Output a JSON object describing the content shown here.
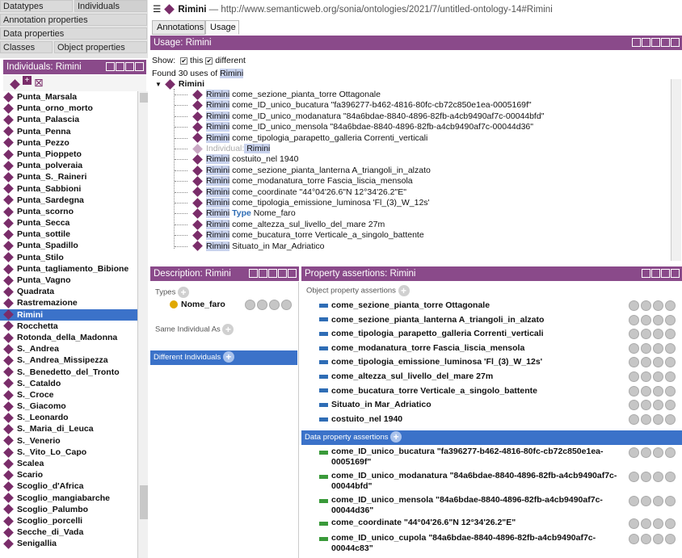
{
  "left_tabs": {
    "datatypes": "Datatypes",
    "individuals": "Individuals",
    "annotation_properties": "Annotation properties",
    "data_properties": "Data properties",
    "classes": "Classes",
    "object_properties": "Object properties"
  },
  "individuals_panel": {
    "title": "Individuals: Rimini",
    "items": [
      "Punta_Marsala",
      "Punta_orno_morto",
      "Punta_Palascia",
      "Punta_Penna",
      "Punta_Pezzo",
      "Punta_Pioppeto",
      "Punta_polveraia",
      "Punta_S._Raineri",
      "Punta_Sabbioni",
      "Punta_Sardegna",
      "Punta_scorno",
      "Punta_Secca",
      "Punta_sottile",
      "Punta_Spadillo",
      "Punta_Stilo",
      "Punta_tagliamento_Bibione",
      "Punta_Vagno",
      "Quadrata",
      "Rastremazione",
      "Rimini",
      "Rocchetta",
      "Rotonda_della_Madonna",
      "S._Andrea",
      "S._Andrea_Missipezza",
      "S._Benedetto_del_Tronto",
      "S._Cataldo",
      "S._Croce",
      "S._Giacomo",
      "S._Leonardo",
      "S._Maria_di_Leuca",
      "S._Venerio",
      "S._Vito_Lo_Capo",
      "Scalea",
      "Scario",
      "Scoglio_d'Africa",
      "Scoglio_mangiabarche",
      "Scoglio_Palumbo",
      "Scoglio_porcelli",
      "Secche_di_Vada",
      "Senigallia"
    ],
    "selected": "Rimini"
  },
  "header": {
    "entity": "Rimini",
    "iri": "— http://www.semanticweb.org/sonia/ontologies/2021/7/untitled-ontology-14#Rimini"
  },
  "tabs": {
    "annotations": "Annotations",
    "usage": "Usage"
  },
  "usage": {
    "title": "Usage: Rimini",
    "show_label": "Show:",
    "this_label": "this",
    "different_label": "different",
    "found_prefix": "Found 30 uses of",
    "found_entity": "Rimini",
    "root": "Rimini",
    "rows": [
      {
        "subj": "Rimini",
        "text": " come_sezione_pianta_torre Ottagonale"
      },
      {
        "subj": "Rimini",
        "text": " come_ID_unico_bucatura \"fa396277-b462-4816-80fc-cb72c850e1ea-0005169f\""
      },
      {
        "subj": "Rimini",
        "text": " come_ID_unico_modanatura \"84a6bdae-8840-4896-82fb-a4cb9490af7c-00044bfd\""
      },
      {
        "subj": "Rimini",
        "text": " come_ID_unico_mensola \"84a6bdae-8840-4896-82fb-a4cb9490af7c-00044d36\""
      },
      {
        "subj": "Rimini",
        "text": " come_tipologia_parapetto_galleria Correnti_verticali"
      },
      {
        "subj": "Individual:",
        "text": " Rimini",
        "grey": true
      },
      {
        "subj": "Rimini",
        "text": " costuito_nel 1940"
      },
      {
        "subj": "Rimini",
        "text": " come_sezione_pianta_lanterna A_triangoli_in_alzato"
      },
      {
        "subj": "Rimini",
        "text": " come_modanatura_torre Fascia_liscia_mensola"
      },
      {
        "subj": "Rimini",
        "text": " come_coordinate \"44°04'26.6\"N 12°34'26.2\"E\""
      },
      {
        "subj": "Rimini",
        "text": " come_tipologia_emissione_luminosa 'Fl_(3)_W_12s'"
      },
      {
        "subj": "Rimini",
        "type": "Type",
        "text": " Nome_faro"
      },
      {
        "subj": "Rimini",
        "text": " come_altezza_sul_livello_del_mare 27m"
      },
      {
        "subj": "Rimini",
        "text": " come_bucatura_torre Verticale_a_singolo_battente"
      },
      {
        "subj": "Rimini",
        "text": " Situato_in Mar_Adriatico"
      }
    ]
  },
  "description": {
    "title": "Description: Rimini",
    "types_label": "Types",
    "type_value": "Nome_faro",
    "same_label": "Same Individual As",
    "different_label": "Different Individuals"
  },
  "property_assertions": {
    "title": "Property assertions: Rimini",
    "object_label": "Object property assertions",
    "object_rows": [
      "come_sezione_pianta_torre  Ottagonale",
      "come_sezione_pianta_lanterna  A_triangoli_in_alzato",
      "come_tipologia_parapetto_galleria  Correnti_verticali",
      "come_modanatura_torre  Fascia_liscia_mensola",
      "come_tipologia_emissione_luminosa  'Fl_(3)_W_12s'",
      "come_altezza_sul_livello_del_mare  27m",
      "come_bucatura_torre  Verticale_a_singolo_battente",
      "Situato_in  Mar_Adriatico",
      "costuito_nel  1940"
    ],
    "data_label": "Data property assertions",
    "data_rows": [
      [
        "come_ID_unico_bucatura  \"fa396277-b462-4816-80fc-cb72c850e1ea-",
        "0005169f\""
      ],
      [
        "come_ID_unico_modanatura  \"84a6bdae-8840-4896-82fb-a4cb9490af7c-",
        "00044bfd\""
      ],
      [
        "come_ID_unico_mensola  \"84a6bdae-8840-4896-82fb-a4cb9490af7c-",
        "00044d36\""
      ],
      [
        "come_coordinate  \"44°04'26.6\"N 12°34'26.2\"E\"",
        ""
      ],
      [
        "come_ID_unico_cupola  \"84a6bdae-8840-4896-82fb-a4cb9490af7c-",
        "00044c83\""
      ]
    ]
  }
}
